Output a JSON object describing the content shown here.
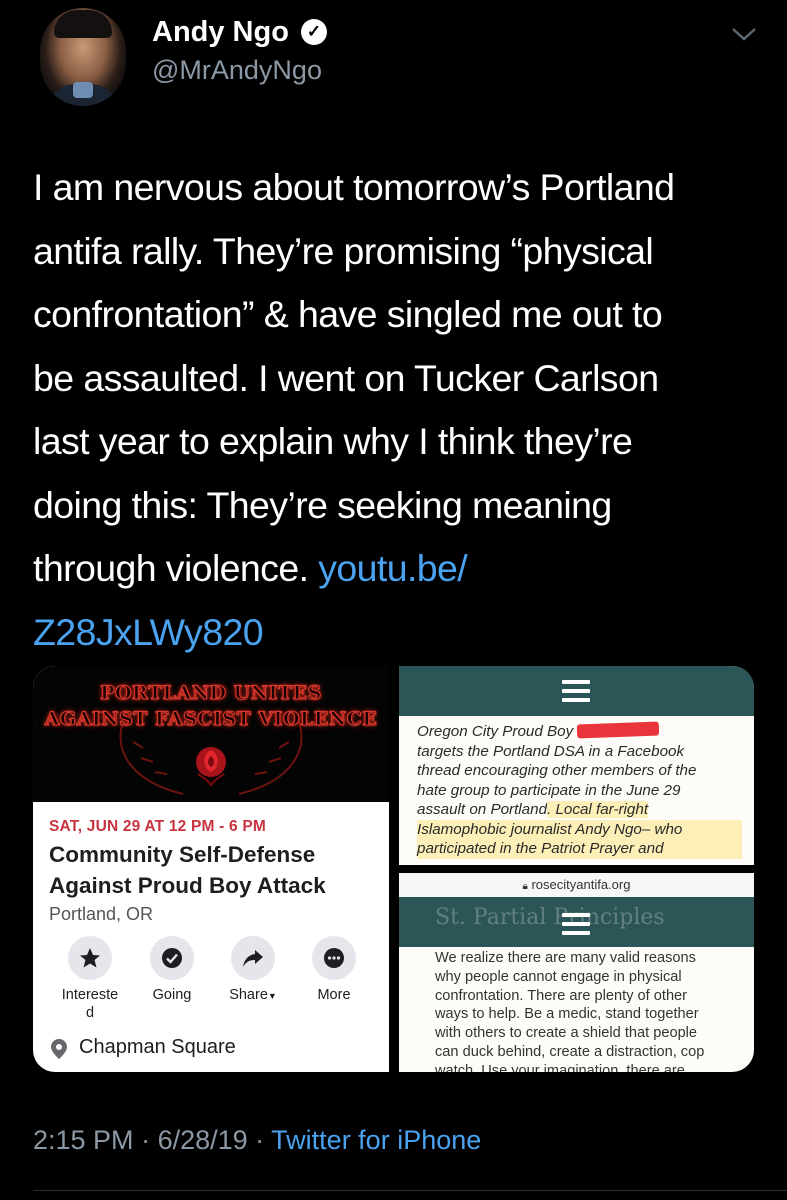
{
  "author": {
    "name": "Andy Ngo",
    "handle": "@MrAndyNgo",
    "verified_icon": "verified-badge-icon"
  },
  "tweet": {
    "text_lines": [
      "I am nervous about tomorrow’s Portland",
      "antifa rally. They’re promising “physical",
      "confrontation” & have singled me out to",
      "be assaulted. I went on Tucker Carlson",
      "last year to explain why I think they’re",
      "doing this: They’re seeking meaning",
      "through violence. "
    ],
    "link_part1": "youtu.be/",
    "link_part2": "Z28JxLWy820",
    "link_color": "#4ba3f0"
  },
  "event_card": {
    "banner_line1": "PORTLAND UNITES",
    "banner_line2": "AGAINST FASCIST VIOLENCE",
    "date": "SAT, JUN 29 AT 12 PM - 6 PM",
    "title_line1": "Community Self-Defense",
    "title_line2": "Against Proud Boy Attack",
    "location": "Portland, OR",
    "actions": [
      {
        "label": "Interested",
        "icon": "star-icon"
      },
      {
        "label": "Going",
        "icon": "check-icon"
      },
      {
        "label": "Share",
        "icon": "share-arrow-icon"
      },
      {
        "label": "More",
        "icon": "more-dots-icon"
      }
    ],
    "interested_line1": "Intereste",
    "interested_line2": "d",
    "share_label": "Share",
    "place": "Chapman Square",
    "date_color": "#c7343f"
  },
  "doc_top": {
    "line1_pre": "Oregon City Proud Boy ",
    "line2": "targets the Portland DSA in a Facebook",
    "line3": "thread encouraging other members of the",
    "line4": "hate group to participate in the June 29",
    "line5_pre": "assault on Portland",
    "line5_hl": ". Local far-right",
    "line6": "Islamophobic journalist Andy Ngo– who",
    "line7": "participated in the Patriot Prayer and"
  },
  "doc_bottom": {
    "url": "rosecityantifa.org",
    "faint_heading": "St. Partial Principles",
    "lines": [
      "We realize there are many valid reasons",
      "why people cannot engage in physical",
      "confrontation. There are plenty of other",
      "ways to help. Be a medic, stand together",
      "with others to create a shield that people",
      "can duck behind, create a distraction, cop",
      "watch. Use your imagination, there are"
    ]
  },
  "footer": {
    "time": "2:15 PM",
    "sep1": " · ",
    "date": "6/28/19",
    "sep2": " · ",
    "source": "Twitter for iPhone"
  },
  "colors": {
    "background": "#000000",
    "secondary_text": "#8b98a5",
    "teal_header": "#2b5556"
  }
}
